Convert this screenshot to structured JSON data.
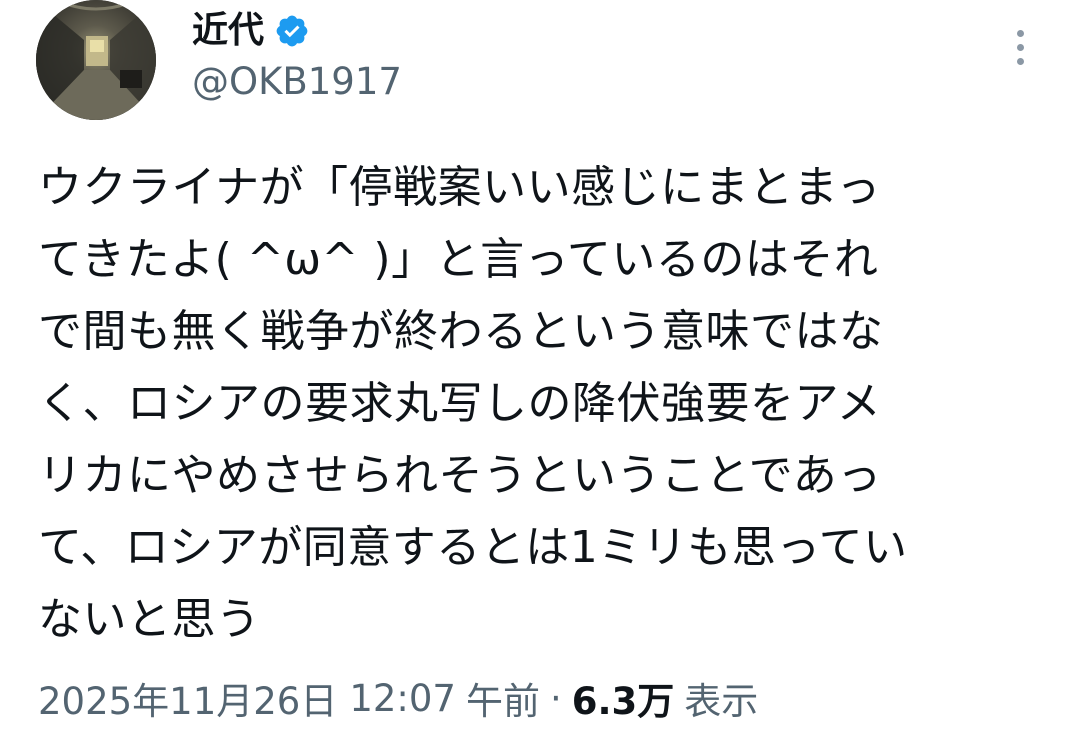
{
  "author": {
    "display_name": "近代",
    "handle": "@OKB1917",
    "verified_icon": "verified-badge-icon",
    "avatar_icon": "tunnel-photo-avatar"
  },
  "more_icon": "more-vertical-icon",
  "tweet": {
    "lines": [
      "ウクライナが「停戦案いい感じにまとまっ",
      "てきたよ( ^ω^ )」と言っているのはそれ",
      "で間も無く戦争が終わるという意味ではな",
      "く、ロシアの要求丸写しの降伏強要をアメ",
      "リカにやめさせられそうということであっ",
      "て、ロシアが同意するとは1ミリも思ってい",
      "ないと思う"
    ]
  },
  "meta": {
    "date": "2025年11月26日",
    "time": "12:07",
    "ampm": "午前",
    "separator": "·",
    "views_count": "6.3万",
    "views_label": "表示"
  },
  "colors": {
    "text": "#0f1419",
    "secondary": "#536471",
    "verified": "#1d9bf0"
  }
}
